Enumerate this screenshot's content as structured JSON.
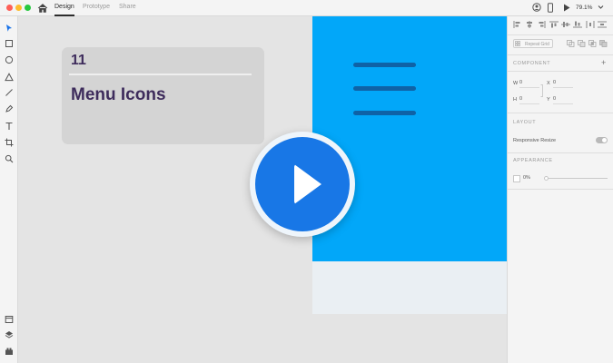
{
  "window": {
    "traffic_lights": [
      "#fe5f57",
      "#febc2e",
      "#28c840"
    ],
    "tabs": [
      {
        "label": "Design",
        "active": true
      },
      {
        "label": "Prototype",
        "active": false
      },
      {
        "label": "Share",
        "active": false
      }
    ],
    "zoom": "79.1%"
  },
  "toolbar": {
    "tools": [
      "select-icon",
      "rectangle-icon",
      "ellipse-icon",
      "polygon-icon",
      "line-icon",
      "pen-icon",
      "text-icon",
      "artboard-icon",
      "zoom-icon"
    ],
    "bottom": [
      "assets-icon",
      "layers-icon",
      "plugins-icon"
    ]
  },
  "canvas": {
    "card": {
      "number": "11",
      "title": "Menu Icons"
    },
    "artboard_color": "#02a7f9",
    "menu_bar_color": "#0f62a6",
    "play_button_color": "#1877e6"
  },
  "panel": {
    "repeat_grid": "Repeat Grid",
    "component": "COMPONENT",
    "w_label": "W",
    "w_value": "0",
    "x_label": "X",
    "x_value": "0",
    "h_label": "H",
    "h_value": "0",
    "y_label": "Y",
    "y_value": "0",
    "layout": "LAYOUT",
    "responsive_resize": "Responsive Resize",
    "appearance": "APPEARANCE",
    "opacity": "0%"
  }
}
